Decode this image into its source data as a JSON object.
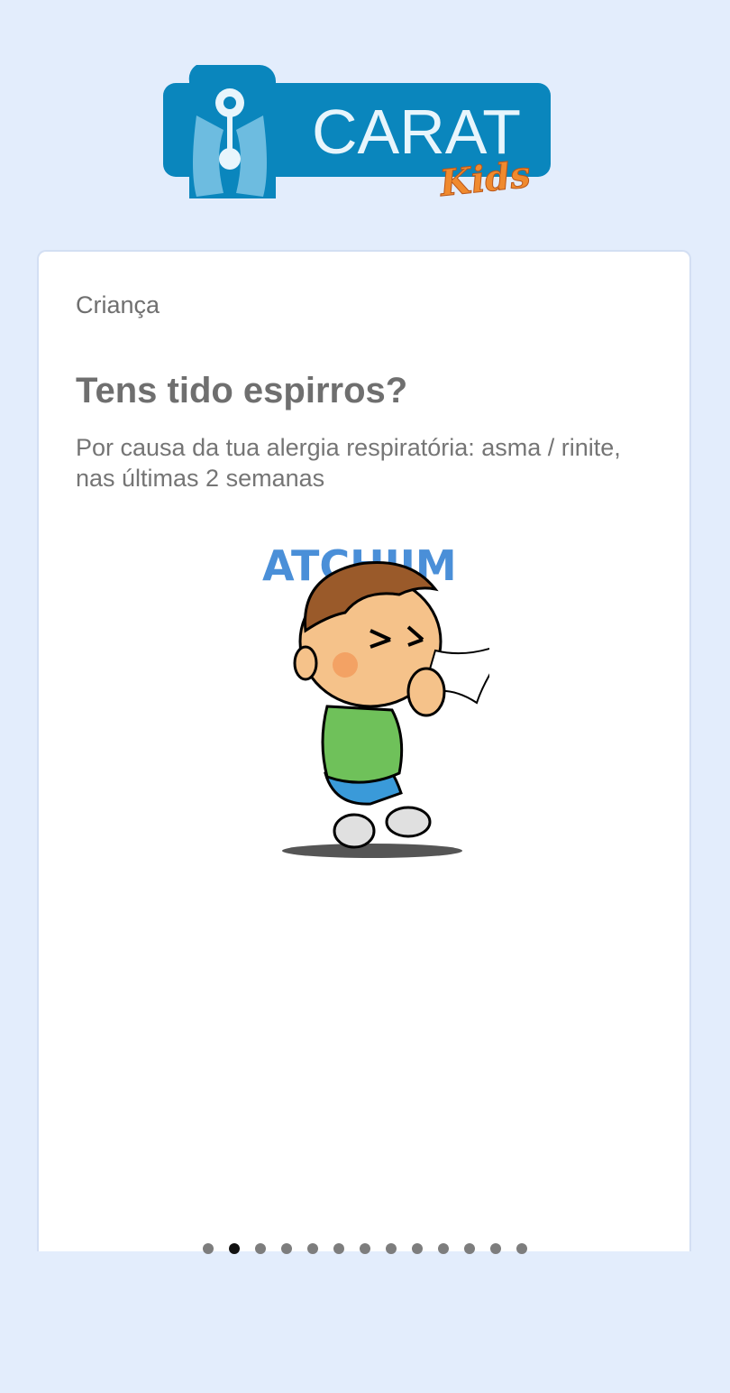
{
  "logo": {
    "brand": "CARAT",
    "sub": "Kids"
  },
  "card": {
    "label": "Criança",
    "question": "Tens tido espirros?",
    "subtitle": "Por causa da tua alergia respiratória: asma / rinite, nas últimas 2 semanas"
  },
  "illustration": {
    "caption": "ATCHIIM"
  },
  "pagination": {
    "total": 13,
    "current": 2
  },
  "colors": {
    "background": "#e3edfc",
    "logo_blue": "#0a86bd",
    "kids_orange": "#f08a2e"
  }
}
